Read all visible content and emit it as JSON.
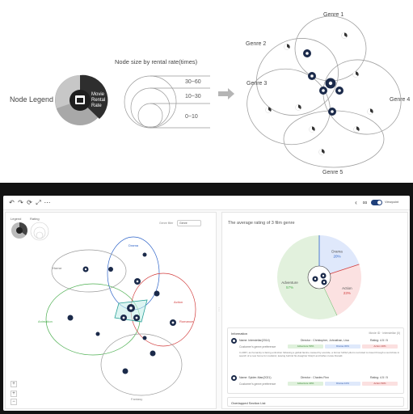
{
  "illustration": {
    "node_legend_label": "Node Legend",
    "legend_badge": "Movie\nRental\nRate",
    "node_size_title": "Node size by rental rate(times)",
    "size_labels": [
      "30~60",
      "10~30",
      "0~10"
    ],
    "genres": [
      "Genre 1",
      "Genre 2",
      "Genre 3",
      "Genre 4",
      "Genre 5"
    ]
  },
  "toolbar": {
    "undo_icon": "undo-icon",
    "redo_icon": "redo-icon",
    "refresh_icon": "refresh-icon",
    "expand_icon": "expand-icon",
    "more_icon": "more-icon",
    "toggle_label": "Viewpoint"
  },
  "left_pane": {
    "legend_small_label": "Legend",
    "legend_small_label2": "Rating",
    "select_label": "Genre filter",
    "select_value": "Genre",
    "genre_labels": [
      "Drama",
      "Horror",
      "Animation",
      "Action",
      "Fantasy",
      "Romance"
    ],
    "zoom_in": "+",
    "zoom_out": "−",
    "reset": "+"
  },
  "right_pane": {
    "chart_title": "The average rating of 3 film genre",
    "chart_data": {
      "type": "pie",
      "categories": [
        "Adventure",
        "Drama",
        "Action"
      ],
      "values": [
        57,
        20,
        23
      ],
      "colors": [
        "#e2f1dd",
        "#dfe8fb",
        "#fbe1e1"
      ]
    },
    "segment_labels": [
      {
        "name": "Adventure",
        "pct": "57%"
      },
      {
        "name": "Drama",
        "pct": "20%"
      },
      {
        "name": "Action",
        "pct": "23%"
      }
    ],
    "info": {
      "title": "Information",
      "date": "Movie ID · Interstellar (0)",
      "movies": [
        {
          "name": "Name: Interstellar(2014)",
          "director": "Director : Christopher, Johnathan, Lisa",
          "rating": "Rating: 4.5 / 5",
          "pref_label": "Customer's genre preference",
          "pills": [
            "Adventure 50%",
            "Drama 30%",
            "Action 20%"
          ],
          "desc": "In 2067, as humanity is facing extinction following a global famine caused by ecocide, a former NASA pilot is recruited to travel through a wormhole in search of a new home for mankind, leaving behind his daughter Murph and father-in-law Donald."
        },
        {
          "name": "Name: Spider-Man(2021)",
          "director": "Director : Charles Finn",
          "rating": "Rating: 4.5 / 5",
          "pref_label": "Customer's genre preference",
          "pills": [
            "Adventure 40%",
            "Drama 10%",
            "Action 50%"
          ],
          "desc": ""
        }
      ]
    },
    "list_title": "Overlapped Section List"
  },
  "colors": {
    "navy": "#1b2a4a",
    "drama": "#2d63c8",
    "action": "#d23c3c",
    "adventure": "#4caf50",
    "teal": "#2aa198",
    "gray": "#9a9a9a"
  }
}
